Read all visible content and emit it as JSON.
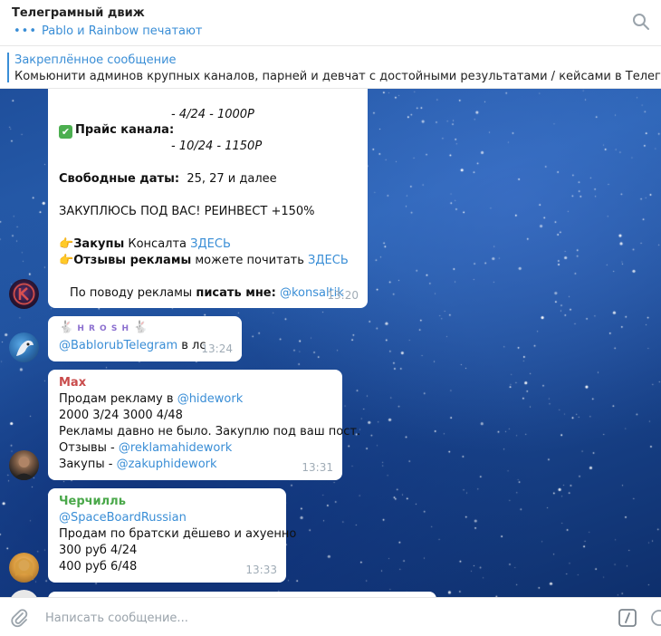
{
  "header": {
    "title": "Телеграмный движ",
    "typing": "Pablo и Rainbow печатают"
  },
  "pinned": {
    "label": "Закреплённое сообщение",
    "text": "Комьюнити админов крупных каналов, парней и девчат с достойными результатами / кейсами в Телеграме  – Обс"
  },
  "messages": {
    "m1": {
      "price_1": "- 4/24 - 1000Р",
      "price_label": "Прайс канала:",
      "price_2": "- 10/24 - 1150Р",
      "free_label": "Свободные даты:",
      "free_value": "25, 27 и далее",
      "promo": "ЗАКУПЛЮСЬ ПОД ВАС! РЕИНВЕСТ +150%",
      "purchases_label": "Закупы",
      "purchases_text": "Консалта",
      "purchases_link": "ЗДЕСЬ",
      "reviews_label": "Отзывы рекламы",
      "reviews_text": "можете почитать",
      "reviews_link": "ЗДЕСЬ",
      "ads_text": "По поводу рекламы",
      "ads_bold": "писать мне:",
      "ads_link": "@konsaltik",
      "time": "13:20"
    },
    "m2": {
      "name": "H R O S H",
      "link": "@BablorubTelegram",
      "suffix": "в лс",
      "time": "13:24"
    },
    "m3": {
      "sender": "Max",
      "line1_text": "Продам рекламу в",
      "line1_link": "@hidework",
      "line2": "2000 3/24 3000 4/48",
      "line3": "Рекламы давно не было. Закуплю под ваш пост.",
      "line4_text": "Отзывы -",
      "line4_link": "@reklamahidework",
      "line5_text": "Закупы -",
      "line5_link": "@zakuphidework",
      "time": "13:31"
    },
    "m4": {
      "sender": "Черчилль",
      "link": "@SpaceBoardRussian",
      "line2": "Продам по братски дёшево и ахуенно",
      "line3": "300 руб 4/24",
      "line4": "400 руб 6/48",
      "time": "13:33"
    }
  },
  "composer": {
    "placeholder": "Написать сообщение..."
  },
  "colors": {
    "accent": "#3a8ed6",
    "sender_max": "#c94b4b",
    "sender_churchill": "#4aa84a"
  }
}
